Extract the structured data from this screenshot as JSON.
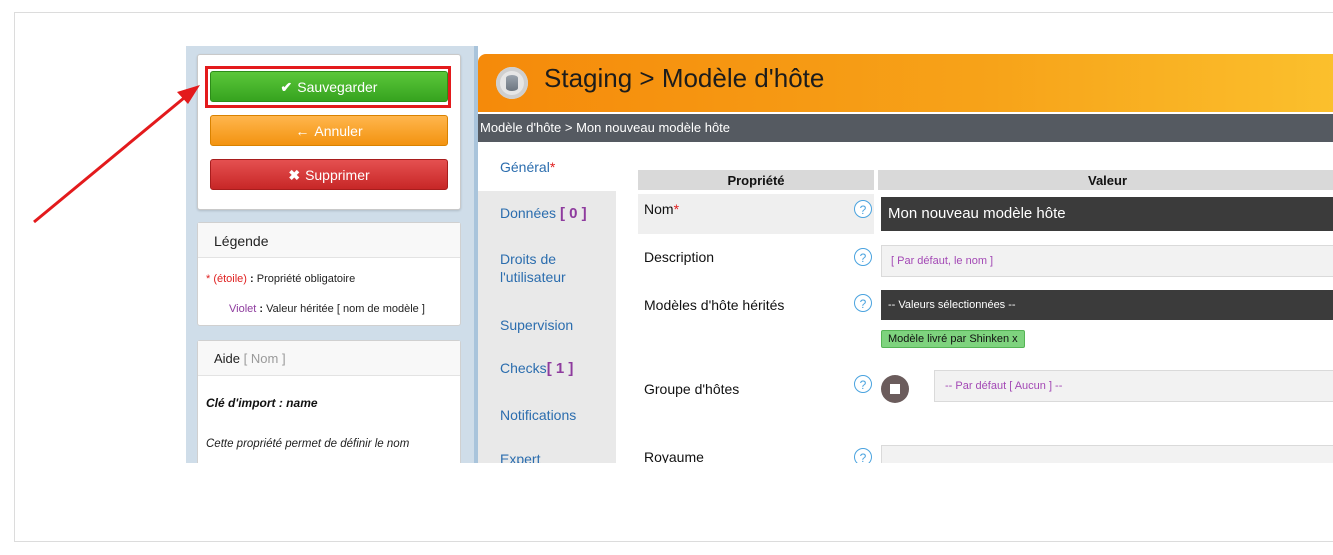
{
  "actions": {
    "save_label": "Sauvegarder",
    "cancel_label": "Annuler",
    "delete_label": "Supprimer"
  },
  "legend": {
    "title": "Légende",
    "row1_marker": "* (étoile)",
    "row1_sep": ":",
    "row1_text": "Propriété obligatoire",
    "row2_marker": "Violet",
    "row2_sep": ":",
    "row2_text": "Valeur héritée [ nom de modèle ]"
  },
  "help": {
    "title": "Aide",
    "title_suffix": "[ Nom ]",
    "key": "Clé d'import : name",
    "description": "Cette propriété permet de définir le nom"
  },
  "header": {
    "title": "Staging > Modèle d'hôte"
  },
  "breadcrumb": "Modèle d'hôte > Mon nouveau modèle hôte",
  "tabs": {
    "general": "Général",
    "general_star": "*",
    "donnees": "Données",
    "donnees_count": "[ 0 ]",
    "droits_line1": "Droits de",
    "droits_line2": "l'utilisateur",
    "supervision": "Supervision",
    "checks": "Checks",
    "checks_count": "[ 1 ]",
    "notifications": "Notifications",
    "expert": "Expert"
  },
  "table": {
    "col_property": "Propriété",
    "col_value": "Valeur",
    "help_glyph": "?",
    "rows": {
      "nom_label": "Nom",
      "nom_star": "*",
      "nom_value": "Mon nouveau modèle hôte",
      "description_label": "Description",
      "description_placeholder": "[ Par défaut, le nom ]",
      "modeles_label": "Modèles d'hôte hérités",
      "modeles_select": "-- Valeurs sélectionnées --",
      "modeles_chip": "Modèle livré par Shinken",
      "modeles_chip_remove": "x",
      "groupe_label": "Groupe d'hôtes",
      "groupe_value": "-- Par défaut [ Aucun ] --",
      "royaume_label": "Royaume"
    }
  },
  "colors": {
    "save": "#36a31f",
    "cancel": "#f39310",
    "delete": "#c72727",
    "header": "#f58a0a",
    "highlight": "#e31a1c"
  },
  "icons": {
    "save": "check-icon",
    "cancel": "arrow-left-icon",
    "delete": "x-icon",
    "header": "database-icon",
    "help": "question-circle-icon"
  }
}
